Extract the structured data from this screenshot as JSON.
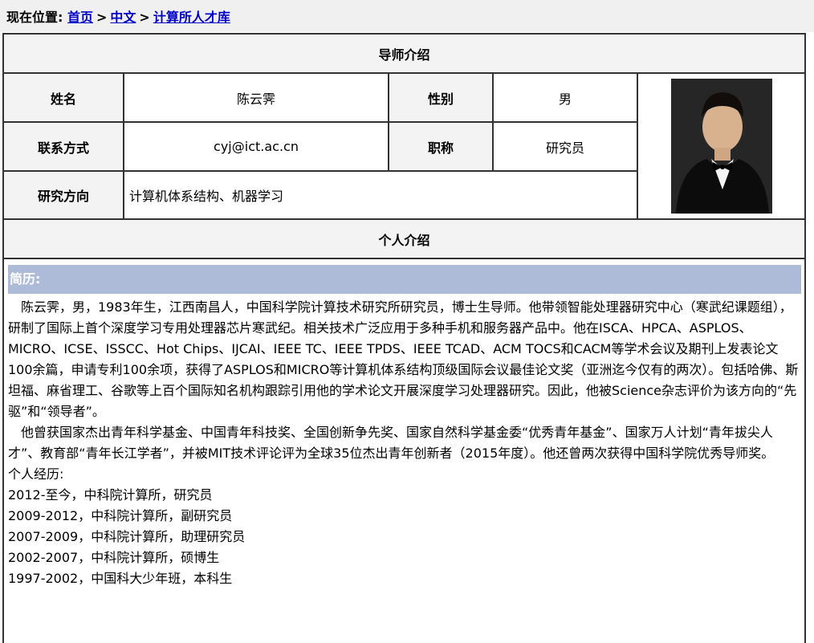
{
  "breadcrumb": {
    "prefix": "现在位置:",
    "links": [
      "首页",
      "中文",
      "计算所人才库"
    ],
    "separator": ">"
  },
  "profile": {
    "section_title": "导师介绍",
    "name_label": "姓名",
    "name": "陈云霁",
    "gender_label": "性别",
    "gender": "男",
    "contact_label": "联系方式",
    "email": "cyj@ict.ac.cn",
    "title_label": "职称",
    "title": "研究员",
    "research_label": "研究方向",
    "research": "计算机体系结构、机器学习"
  },
  "intro": {
    "section_title": "个人介绍",
    "resume_label": "简历:",
    "para1": "陈云霁，男，1983年生，江西南昌人，中国科学院计算技术研究所研究员，博士生导师。他带领智能处理器研究中心（寒武纪课题组），研制了国际上首个深度学习专用处理器芯片寒武纪。相关技术广泛应用于多种手机和服务器产品中。他在ISCA、HPCA、ASPLOS、MICRO、ICSE、ISSCC、Hot Chips、IJCAI、IEEE TC、IEEE TPDS、IEEE TCAD、ACM TOCS和CACM等学术会议及期刊上发表论文100余篇，申请专利100余项，获得了ASPLOS和MICRO等计算机体系结构顶级国际会议最佳论文奖（亚洲迄今仅有的两次）。包括哈佛、斯坦福、麻省理工、谷歌等上百个国际知名机构跟踪引用他的学术论文开展深度学习处理器研究。因此，他被Science杂志评价为该方向的“先驱”和“领导者”。",
    "para2": "他曾获国家杰出青年科学基金、中国青年科技奖、全国创新争先奖、国家自然科学基金委“优秀青年基金”、国家万人计划“青年拔尖人才”、教育部“青年长江学者”，并被MIT技术评论评为全球35位杰出青年创新者（2015年度）。他还曾两次获得中国科学院优秀导师奖。",
    "experience_label": "个人经历:",
    "experience": [
      "2012-至今，中科院计算所，研究员",
      "2009-2012，中科院计算所，副研究员",
      "2007-2009，中科院计算所，助理研究员",
      "2002-2007，中科院计算所，硕博生",
      "1997-2002，中国科大少年班，本科生"
    ]
  }
}
